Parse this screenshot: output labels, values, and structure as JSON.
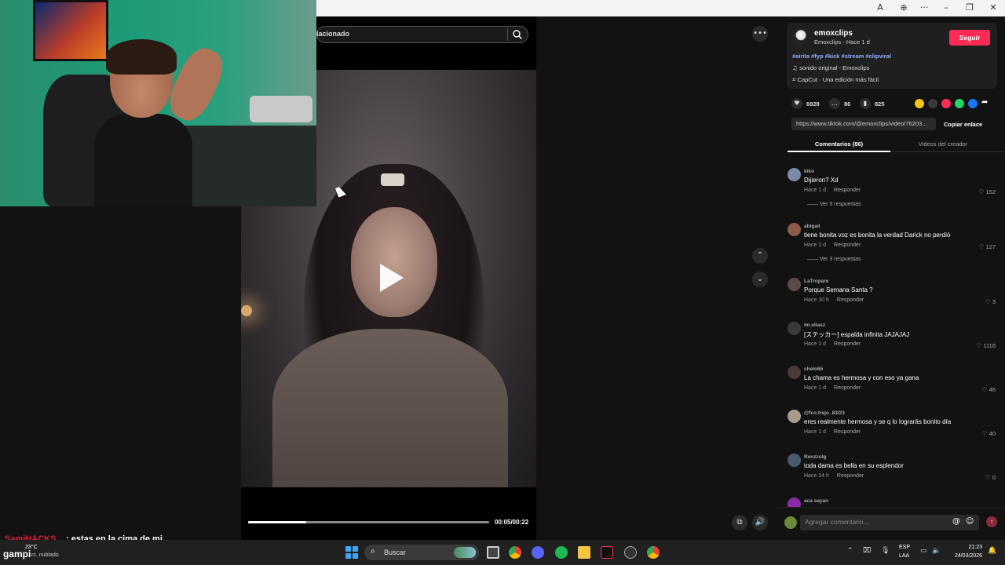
{
  "browser": {
    "controls": [
      "translate-icon",
      "zoom-icon",
      "more-icon",
      "minimize",
      "restore",
      "close"
    ]
  },
  "search": {
    "value": "lacionado"
  },
  "video": {
    "current_time": "00:05",
    "duration": "00:22",
    "time_label": "00:05/00:22",
    "progress": 0.24
  },
  "post": {
    "username": "emoxclips",
    "subline": "Emoxclips · Hace 1 d",
    "follow_label": "Seguir",
    "tags": "#airita #fyp #kick #stream #clipviral",
    "sound": "sonido original - Emoxclips",
    "capcut": "CapCut · Una edición más fácil",
    "likes": "6928",
    "comments": "86",
    "saves": "825",
    "link": "https://www.tiktok.com/@emoxclips/video/76203...",
    "copy_label": "Copiar enlace"
  },
  "tabs": {
    "comments": "Comentarios (86)",
    "videos": "Videos del creador"
  },
  "comments": [
    {
      "user": "kiko",
      "text": "Dijieron? Xd",
      "time": "Hace 1 d",
      "reply": "Responder",
      "likes": "152",
      "more": "Ver 5 respuestas",
      "avatar_color": "#7a8aa8"
    },
    {
      "user": "abigail",
      "text": "tiene bonita voz es bonita la verdad Darick no perdió",
      "time": "Hace 1 d",
      "reply": "Responder",
      "likes": "127",
      "more": "Ver 3 respuestas",
      "avatar_color": "#8a5a4a"
    },
    {
      "user": "LaTropare",
      "text": "Porque Semana Santa ?",
      "time": "Hace 10 h",
      "reply": "Responder",
      "likes": "3",
      "avatar_color": "#5a4a4a"
    },
    {
      "user": "im.eliasz",
      "text": "[ステッカー] espalda infinita JAJAJAJ",
      "time": "Hace 1 d",
      "reply": "Responder",
      "likes": "1116",
      "avatar_color": "#3a3a3a"
    },
    {
      "user": "chelo66",
      "text": "La chama es hermosa y con eso ya gana",
      "time": "Hace 1 d",
      "reply": "Responder",
      "likes": "46",
      "avatar_color": "#4a3a3a"
    },
    {
      "user": "@fco.trejo_83/23",
      "text": "eres realmente hermosa y se q lo lograrás bonito día",
      "time": "Hace 1 d",
      "reply": "Responder",
      "likes": "40",
      "avatar_color": "#a89a8a"
    },
    {
      "user": "Renzzolg",
      "text": "toda dama es bella en su esplendor",
      "time": "Hace 14 h",
      "reply": "Responder",
      "likes": "0",
      "avatar_color": "#4a5a6a"
    },
    {
      "user": "aca sayan",
      "text": "",
      "time": "",
      "reply": "",
      "likes": "",
      "avatar_color": "#8a2aa8"
    }
  ],
  "comment_input": {
    "placeholder": "Agregar comentario..."
  },
  "chat": {
    "user": "SamiHACKS",
    "message": ": estas en la cima de mi",
    "user2": "gampi"
  },
  "taskbar": {
    "weather_temp": "23°C",
    "weather_desc": "rc. nublado",
    "search_label": "Buscar",
    "lang1": "ESP",
    "lang2": "LAA",
    "time": "21:23",
    "date": "24/03/2026"
  },
  "colors": {
    "accent": "#fe2c55",
    "panel_bg": "#121212",
    "tag_blue": "#8fb2ff"
  }
}
